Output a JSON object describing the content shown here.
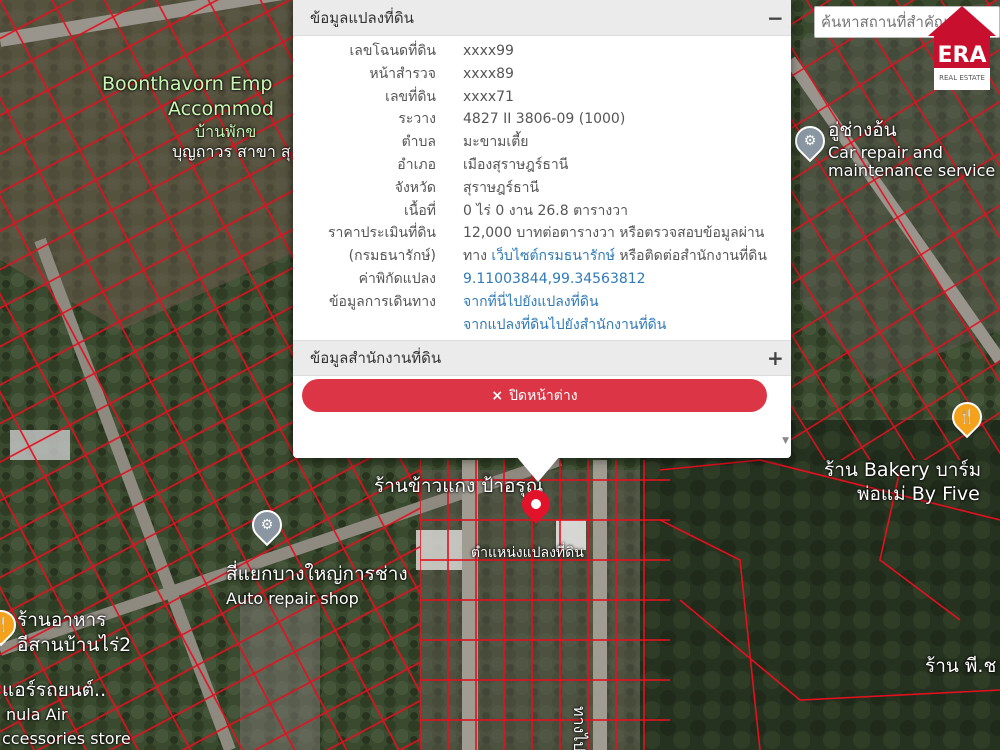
{
  "search": {
    "placeholder": "ค้นหาสถานที่สำคัญ"
  },
  "logo": {
    "text": "ERA",
    "subtext": "REAL ESTATE"
  },
  "map_labels": {
    "accommodation": "Boonthavorn Emp",
    "accommodation_2": "Accommod",
    "accommodation_th": "บ้านพักข",
    "accommodation_th2": "บุญถาวร สาขา สุ",
    "car_repair_th": "อู่ช่างอ้น",
    "car_repair_en1": "Car repair and",
    "car_repair_en2": "maintenance service",
    "bakery_1": "ร้าน Bakery บาร์ม",
    "bakery_2": "พ่อแม่ By Five",
    "curry_shop": "ร้านข้าวแกง ป้าอรุณ",
    "auto_shop_th": "สี่แยกบางใหญ่การช่าง",
    "auto_shop_en": "Auto repair shop",
    "isan_food_1": "ร้านอาหาร",
    "isan_food_2": "อีสานบ้านไร่2",
    "air_1": "แอร์รถยนต์..",
    "air_2": "nula Air",
    "air_3": "ccessories store",
    "shop_pk": "ร้าน พี.ช",
    "road": "ทางไป"
  },
  "marker": {
    "label": "ตำแหน่งแปลงที่ดิน",
    "color": "#e3122b"
  },
  "popup": {
    "section_title": "ข้อมูลแปลงที่ดิน",
    "section_toggle": "−",
    "rows": [
      {
        "key": "เลขโฉนดที่ดิน",
        "value": "xxxx99"
      },
      {
        "key": "หน้าสำรวจ",
        "value": "xxxx89"
      },
      {
        "key": "เลขที่ดิน",
        "value": "xxxx71"
      },
      {
        "key": "ระวาง",
        "value": "4827 II 3806-09 (1000)"
      },
      {
        "key": "ตำบล",
        "value": "มะขามเตี้ย"
      },
      {
        "key": "อำเภอ",
        "value": "เมืองสุราษฎร์ธานี"
      },
      {
        "key": "จังหวัด",
        "value": "สุราษฎร์ธานี"
      },
      {
        "key": "เนื้อที่",
        "value": "0 ไร่ 0 งาน 26.8 ตารางวา"
      }
    ],
    "price": {
      "key": "ราคาประเมินที่ดิน",
      "key2": "(กรมธนารักษ์)",
      "line1": "12,000 บาทต่อตารางวา หรือตรวจสอบข้อมูลผ่าน",
      "line2_pre": "ทาง ",
      "line2_link": "เว็บไซต์กรมธนารักษ์",
      "line2_post": " หรือติดต่อสำนักงานที่ดิน"
    },
    "coords": {
      "key": "ค่าพิกัดแปลง",
      "value": "9.11003844,99.34563812"
    },
    "travel": {
      "key": "ข้อมูลการเดินทาง",
      "link1": "จากที่นี่ไปยังแปลงที่ดิน",
      "link2": "จากแปลงที่ดินไปยังสำนักงานที่ดิน"
    },
    "office_title": "ข้อมูลสำนักงานที่ดิน",
    "office_toggle": "+",
    "close_label": "ปิดหน้าต่าง",
    "close_icon": "×",
    "link_color": "#2f7ab8",
    "button_color": "#dc3545"
  }
}
